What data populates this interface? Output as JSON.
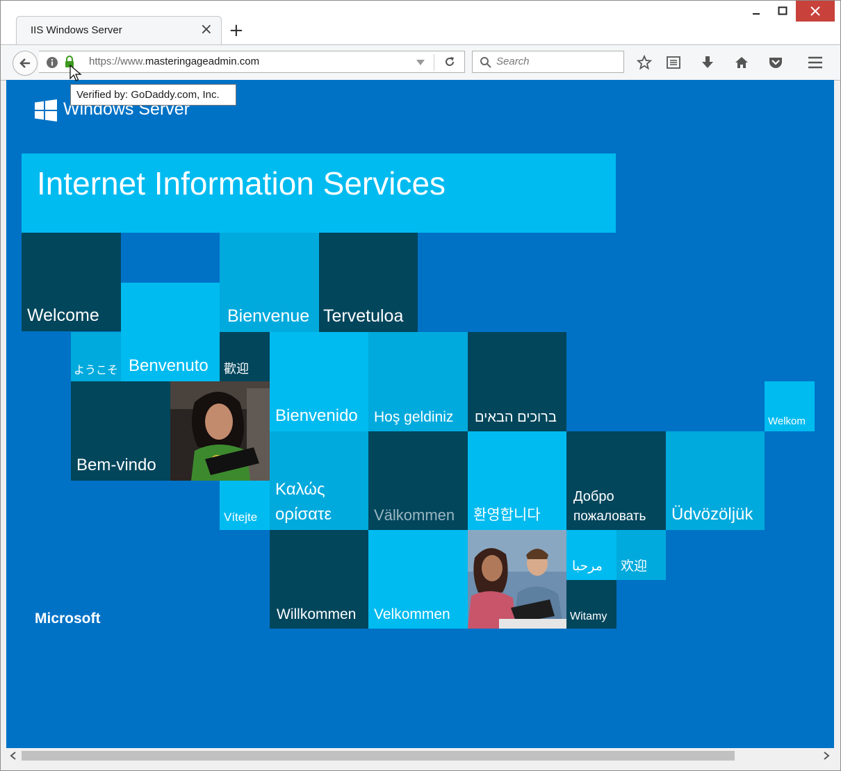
{
  "window": {
    "minimize_glyph": "—",
    "maximize_glyph": "□",
    "close_glyph": "✕"
  },
  "tab": {
    "title": "IIS Windows Server",
    "close_glyph": "×",
    "new_tab_glyph": "+"
  },
  "navbar": {
    "url_prefix": "https://www.",
    "url_domain": "masteringageadmin.com",
    "search_placeholder": "Search",
    "icons": [
      "back-icon",
      "info-icon",
      "lock-icon",
      "dropdown-icon",
      "reload-icon",
      "search-icon",
      "bookmark-star-icon",
      "reading-list-icon",
      "download-icon",
      "home-icon",
      "pocket-icon",
      "menu-icon"
    ]
  },
  "tooltip": {
    "text": "Verified by: GoDaddy.com, Inc."
  },
  "page": {
    "logo_text": "Windows Server",
    "banner_title": "Internet Information Services",
    "footer_brand": "Microsoft",
    "tiles": {
      "welcome": "Welcome",
      "bienvenue": "Bienvenue",
      "tervetuloa": "Tervetuloa",
      "youkoso": "ようこそ",
      "benvenuto": "Benvenuto",
      "huanying_trad": "歡迎",
      "bienvenido": "Bienvenido",
      "hos_geldiniz": "Hoş geldiniz",
      "hebrew": "ברוכים הבאים",
      "welkom": "Welkom",
      "bem_vindo": "Bem-vindo",
      "kalos_1": "Καλώς",
      "kalos_2": "ορίσατε",
      "valkommen": "Välkommen",
      "korean": "환영합니다",
      "dobro_1": "Добро",
      "dobro_2": "пожаловать",
      "udvozoljuk": "Üdvözöljük",
      "vitejte": "Vítejte",
      "marhaba": "مرحبا",
      "huanying_simp": "欢迎",
      "willkommen": "Willkommen",
      "velkommen": "Velkommen",
      "witamy": "Witamy"
    }
  },
  "colors": {
    "page_bg": "#0072c6",
    "tile_dark": "#02465c",
    "tile_light": "#00bbf0",
    "tile_mid": "#00aadd",
    "close_button": "#c8413b"
  }
}
